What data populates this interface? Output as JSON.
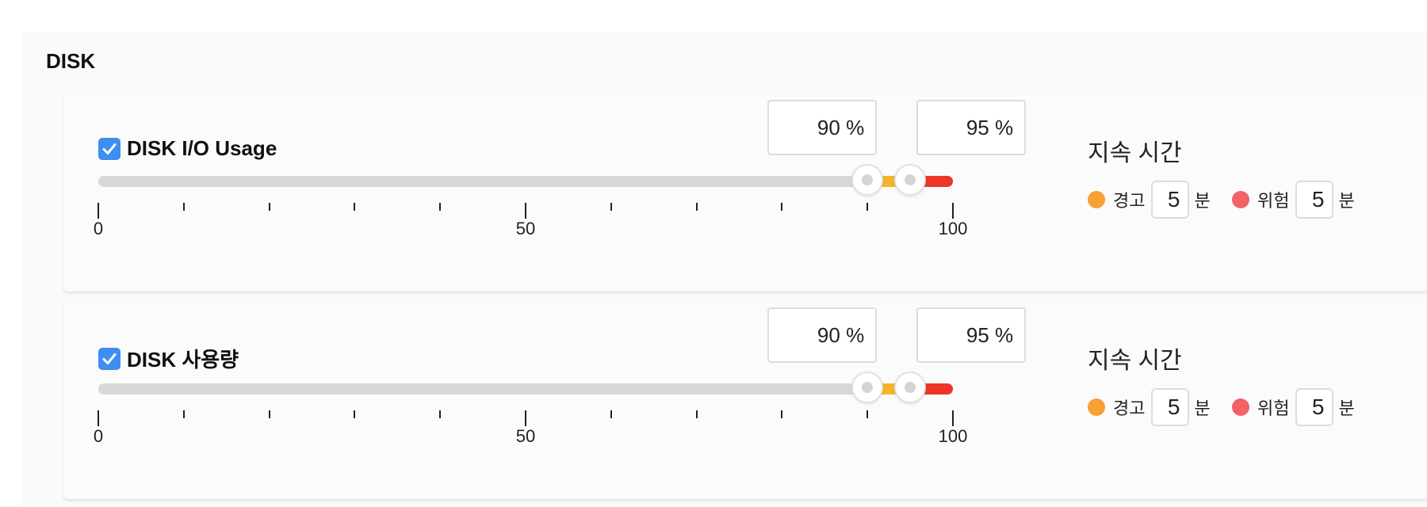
{
  "section": {
    "title": "DISK"
  },
  "colors": {
    "checkbox": "#3d8ef0",
    "warning_segment": "#f5b429",
    "critical_segment": "#ee3628",
    "warning_dot": "#f7a035",
    "danger_dot": "#f26266"
  },
  "icons": {
    "checkbox": "checkmark-icon",
    "handle": "slider-handle-icon"
  },
  "scale": {
    "min": 0,
    "max": 100,
    "tick_labels": [
      "0",
      "50",
      "100"
    ]
  },
  "metrics": [
    {
      "label": "DISK I/O Usage",
      "checked": true,
      "warning_threshold": 90,
      "critical_threshold": 95,
      "warning_text": "90 %",
      "critical_text": "95 %",
      "duration": {
        "title": "지속 시간",
        "warning_label": "경고",
        "warning_value": "5",
        "danger_label": "위험",
        "danger_value": "5",
        "unit": "분"
      }
    },
    {
      "label": "DISK 사용량",
      "checked": true,
      "warning_threshold": 90,
      "critical_threshold": 95,
      "warning_text": "90 %",
      "critical_text": "95 %",
      "duration": {
        "title": "지속 시간",
        "warning_label": "경고",
        "warning_value": "5",
        "danger_label": "위험",
        "danger_value": "5",
        "unit": "분"
      }
    }
  ]
}
